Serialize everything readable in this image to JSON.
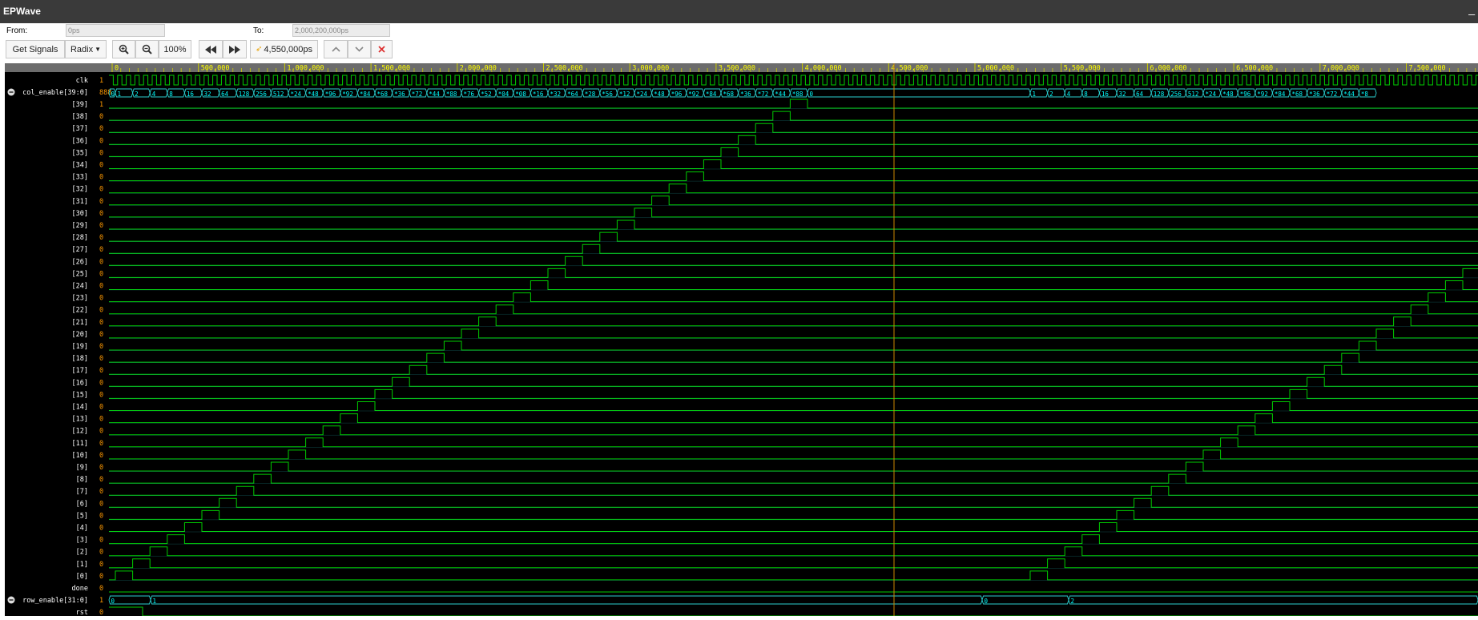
{
  "window": {
    "title": "EPWave",
    "minimize_label": "_"
  },
  "range": {
    "from_label": "From:",
    "from_value": "0ps",
    "to_label": "To:",
    "to_value": "2,000,200,000ps"
  },
  "toolbar": {
    "get_signals": "Get Signals",
    "radix": "Radix",
    "zoom_level": "100%",
    "cursor_time": "4,550,000ps"
  },
  "timeline": {
    "ticks": [
      "0",
      "500,000",
      "1,000,000",
      "1,500,000",
      "2,000,000",
      "2,500,000",
      "3,000,000",
      "3,500,000",
      "4,000,000",
      "4,500,000",
      "5,000,000",
      "5,500,000",
      "6,000,000",
      "6,500,000",
      "7,000,000",
      "7,500,000"
    ]
  },
  "signals": {
    "clk": {
      "name": "clk",
      "value": "1"
    },
    "col_enable": {
      "name": "col_enable[39:0]",
      "value": "888"
    },
    "bits": [
      {
        "name": "[39]",
        "value": "1"
      },
      {
        "name": "[38]",
        "value": "0"
      },
      {
        "name": "[37]",
        "value": "0"
      },
      {
        "name": "[36]",
        "value": "0"
      },
      {
        "name": "[35]",
        "value": "0"
      },
      {
        "name": "[34]",
        "value": "0"
      },
      {
        "name": "[33]",
        "value": "0"
      },
      {
        "name": "[32]",
        "value": "0"
      },
      {
        "name": "[31]",
        "value": "0"
      },
      {
        "name": "[30]",
        "value": "0"
      },
      {
        "name": "[29]",
        "value": "0"
      },
      {
        "name": "[28]",
        "value": "0"
      },
      {
        "name": "[27]",
        "value": "0"
      },
      {
        "name": "[26]",
        "value": "0"
      },
      {
        "name": "[25]",
        "value": "0"
      },
      {
        "name": "[24]",
        "value": "0"
      },
      {
        "name": "[23]",
        "value": "0"
      },
      {
        "name": "[22]",
        "value": "0"
      },
      {
        "name": "[21]",
        "value": "0"
      },
      {
        "name": "[20]",
        "value": "0"
      },
      {
        "name": "[19]",
        "value": "0"
      },
      {
        "name": "[18]",
        "value": "0"
      },
      {
        "name": "[17]",
        "value": "0"
      },
      {
        "name": "[16]",
        "value": "0"
      },
      {
        "name": "[15]",
        "value": "0"
      },
      {
        "name": "[14]",
        "value": "0"
      },
      {
        "name": "[13]",
        "value": "0"
      },
      {
        "name": "[12]",
        "value": "0"
      },
      {
        "name": "[11]",
        "value": "0"
      },
      {
        "name": "[10]",
        "value": "0"
      },
      {
        "name": "[9]",
        "value": "0"
      },
      {
        "name": "[8]",
        "value": "0"
      },
      {
        "name": "[7]",
        "value": "0"
      },
      {
        "name": "[6]",
        "value": "0"
      },
      {
        "name": "[5]",
        "value": "0"
      },
      {
        "name": "[4]",
        "value": "0"
      },
      {
        "name": "[3]",
        "value": "0"
      },
      {
        "name": "[2]",
        "value": "0"
      },
      {
        "name": "[1]",
        "value": "0"
      },
      {
        "name": "[0]",
        "value": "0"
      }
    ],
    "done": {
      "name": "done",
      "value": "0"
    },
    "row_enable": {
      "name": "row_enable[31:0]",
      "value": "1"
    },
    "rst": {
      "name": "rst",
      "value": "0"
    }
  },
  "bus_values": {
    "col_first": [
      "0",
      "1",
      "2",
      "4",
      "8",
      "16",
      "32",
      "64",
      "128",
      "256",
      "512",
      "*24",
      "*48",
      "*96",
      "*92",
      "*84",
      "*68",
      "*36",
      "*72",
      "*44",
      "*88",
      "*76",
      "*52",
      "*04",
      "*08",
      "*16",
      "*32",
      "*64",
      "*28",
      "*56",
      "*12",
      "*24",
      "*48",
      "*96",
      "*92",
      "*84",
      "*68",
      "*36",
      "*72",
      "*44",
      "*88"
    ],
    "col_idle": "0",
    "col_second": [
      "1",
      "2",
      "4",
      "8",
      "16",
      "32",
      "64",
      "128",
      "256",
      "512",
      "*24",
      "*48",
      "*96",
      "*92",
      "*84",
      "*68",
      "*36",
      "*72",
      "*44",
      "*8"
    ],
    "row": [
      "0",
      "1",
      "0",
      "2"
    ]
  },
  "colors": {
    "signal_name": "#ffffff",
    "value": "#ff9900",
    "wave": "#00cc00",
    "bus_text": "#00ffff",
    "ruler_bg": "#6c6c6c",
    "ruler_text": "#ffff00",
    "cursor": "#cc8800",
    "bus_line": "#2bd0d0"
  },
  "icons": {
    "zoom_in": "zoom-in-icon",
    "zoom_out": "zoom-out-icon",
    "rewind": "rewind-icon",
    "forward": "forward-icon",
    "up": "chevron-up-icon",
    "down": "chevron-down-icon",
    "close": "close-icon",
    "expand": "expand-icon"
  }
}
